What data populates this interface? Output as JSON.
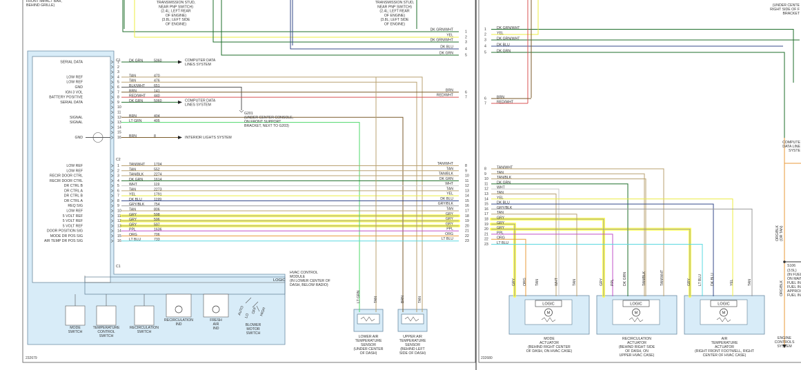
{
  "left_page": {
    "figure_number": "232679",
    "top_notes": {
      "top_left": "FRONT IMPACT BAR,\nBEHIND GRILLE)",
      "stud_1": "TRANSMISSION STUD,\nNEAR PNP SWITCH)\n(2.4L; LEFT REAR\nOF ENGINE)\n(3.8L; LEFT SIDE\nOF ENGINE)",
      "stud_2": "TRANSMISSION STUD,\nNEAR PNP SWITCH)\n(2.4L; LEFT REAR\nOF ENGINE)\n(3.8L; LEFT SIDE\nOF ENGINE)"
    },
    "top_wires": [
      {
        "num": "1",
        "label": "DK GRN/WHT"
      },
      {
        "num": "2",
        "label": "YEL"
      },
      {
        "num": "3",
        "label": "DK GRN/WHT"
      },
      {
        "num": "4",
        "label": "DK BLU"
      },
      {
        "num": "5",
        "label": "DK GRN"
      }
    ],
    "module": {
      "title": "HVAC CONTROL\nMODULE\n(IN LOWER CENTER OF\nDASH, BELOW RADIO)",
      "logic_label": "LOGIC",
      "c1_label": "C1",
      "c2_label": "C2",
      "c2_end_label": "C1"
    },
    "c1_pins": [
      {
        "pin": "1",
        "sig": "SERIAL DATA",
        "color": "DK GRN",
        "circuit": "5060",
        "dest": "COMPUTER DATA\nLINES SYSTEM",
        "right_label": "",
        "right_num": ""
      },
      {
        "pin": "2",
        "sig": "",
        "color": "",
        "circuit": "",
        "dest": "",
        "right_label": "",
        "right_num": ""
      },
      {
        "pin": "3",
        "sig": "",
        "color": "",
        "circuit": "",
        "dest": "",
        "right_label": "",
        "right_num": ""
      },
      {
        "pin": "4",
        "sig": "LOW REF",
        "color": "TAN",
        "circuit": "470",
        "dest": "",
        "right_label": "",
        "right_num": ""
      },
      {
        "pin": "5",
        "sig": "LOW REF",
        "color": "TAN",
        "circuit": "476",
        "dest": "",
        "right_label": "",
        "right_num": ""
      },
      {
        "pin": "6",
        "sig": "GND",
        "color": "BLK/WHT",
        "circuit": "651",
        "dest": "",
        "right_label": "",
        "right_num": ""
      },
      {
        "pin": "7",
        "sig": "IGN 3 VOL",
        "color": "BRN",
        "circuit": "141",
        "dest": "",
        "right_label": "BRN",
        "right_num": "6"
      },
      {
        "pin": "8",
        "sig": "BATTERY POSITIVE",
        "color": "RED/WHT",
        "circuit": "440",
        "dest": "",
        "right_label": "RED/WHT",
        "right_num": "7"
      },
      {
        "pin": "9",
        "sig": "SERIAL DATA",
        "color": "DK GRN",
        "circuit": "5060",
        "dest": "COMPUTER DATA\nLINES SYSTEM",
        "right_label": "",
        "right_num": ""
      },
      {
        "pin": "10",
        "sig": "",
        "color": "",
        "circuit": "",
        "dest": "",
        "right_label": "",
        "right_num": ""
      },
      {
        "pin": "11",
        "sig": "",
        "color": "",
        "circuit": "",
        "dest": "",
        "right_label": "",
        "right_num": ""
      },
      {
        "pin": "12",
        "sig": "SIGNAL",
        "color": "BRN",
        "circuit": "404",
        "dest": "",
        "right_label": "",
        "right_num": ""
      },
      {
        "pin": "13",
        "sig": "SIGNAL",
        "color": "LT GRN",
        "circuit": "405",
        "dest": "",
        "right_label": "",
        "right_num": ""
      },
      {
        "pin": "14",
        "sig": "",
        "color": "",
        "circuit": "",
        "dest": "",
        "right_label": "",
        "right_num": ""
      },
      {
        "pin": "15",
        "sig": "",
        "color": "",
        "circuit": "",
        "dest": "",
        "right_label": "",
        "right_num": ""
      },
      {
        "pin": "16",
        "sig": "GND",
        "color": "BRN",
        "circuit": "8",
        "dest": "INTERIOR LIGHTS SYSTEM",
        "right_label": "",
        "right_num": ""
      }
    ],
    "ground": {
      "name": "G201",
      "desc": "(UNDER CENTER CONSOLE,\nON FRONT SUPPORT\nBRACKET, NEXT TO G203)"
    },
    "c2_pins": [
      {
        "pin": "1",
        "sig": "LOW REF",
        "color": "TAN/WHT",
        "circuit": "1704",
        "right_label": "TAN/WHT",
        "right_num": "8"
      },
      {
        "pin": "2",
        "sig": "LOW REF",
        "color": "TAN",
        "circuit": "552",
        "right_label": "TAN",
        "right_num": "9"
      },
      {
        "pin": "3",
        "sig": "RECIR DOOR CTRL",
        "color": "TAN/BLK",
        "circuit": "2274",
        "right_label": "TAN/BLK",
        "right_num": "10"
      },
      {
        "pin": "4",
        "sig": "RECIR DOOR CTRL",
        "color": "DK GRN",
        "circuit": "1614",
        "right_label": "DK GRN",
        "right_num": "11"
      },
      {
        "pin": "5",
        "sig": "DR CTRL B",
        "color": "WHT",
        "circuit": "119",
        "right_label": "WHT",
        "right_num": "12"
      },
      {
        "pin": "6",
        "sig": "DR CTRL A",
        "color": "TAN",
        "circuit": "2273",
        "right_label": "TAN",
        "right_num": "13"
      },
      {
        "pin": "7",
        "sig": "DR CTRL B",
        "color": "YEL",
        "circuit": "1791",
        "right_label": "YEL",
        "right_num": "14"
      },
      {
        "pin": "8",
        "sig": "DR CTRL A",
        "color": "DK BLU",
        "circuit": "1199",
        "right_label": "DK BLU",
        "right_num": "15"
      },
      {
        "pin": "9",
        "sig": "REQ SIG",
        "color": "GRY/BLK",
        "circuit": "754",
        "right_label": "GRY/BLK",
        "right_num": "16"
      },
      {
        "pin": "10",
        "sig": "LOW REF",
        "color": "TAN",
        "circuit": "806",
        "right_label": "TAN",
        "right_num": "17"
      },
      {
        "pin": "11",
        "sig": "5 VOLT REF",
        "color": "GRY",
        "circuit": "598",
        "right_label": "GRY",
        "right_num": "18"
      },
      {
        "pin": "12",
        "sig": "5 VOLT REF",
        "color": "GRY",
        "circuit": "596",
        "right_label": "GRY",
        "right_num": "19"
      },
      {
        "pin": "13",
        "sig": "5 VOLT REF",
        "color": "GRY",
        "circuit": "597",
        "right_label": "GRY",
        "right_num": "20"
      },
      {
        "pin": "14",
        "sig": "DOOR POSITION SIG",
        "color": "PPL",
        "circuit": "1636",
        "right_label": "PPL",
        "right_num": "21"
      },
      {
        "pin": "15",
        "sig": "MODE DR POS SIG",
        "color": "ORG",
        "circuit": "706",
        "right_label": "ORG",
        "right_num": "22"
      },
      {
        "pin": "16",
        "sig": "AIR TEMP DR POS SIG",
        "color": "LT BLU",
        "circuit": "733",
        "right_label": "LT BLU",
        "right_num": "23"
      }
    ],
    "switches": [
      {
        "label": "MODE\nSWITCH"
      },
      {
        "label": "TEMPERATURE\nCONTROL\nSWITCH"
      },
      {
        "label": "RECIRCULATION\nSWITCH"
      },
      {
        "label": "RECIRCULATION\nIND"
      },
      {
        "label": "FRESH\nAIR\nIND"
      },
      {
        "label": "BLOWER\nMOTOR\nSWITCH",
        "positions": [
          "AUTO",
          "LO",
          "OFF",
          "HIGH"
        ]
      }
    ],
    "sensors": [
      {
        "label": "LOWER AIR\nTEMPERATURE\nSENSOR\n(UNDER CENTER\nOF DASH)",
        "wires": [
          "LT GRN",
          "TAN"
        ]
      },
      {
        "label": "UPPER AIR\nTEMPERATURE\nSENSOR\n(BEHIND LEFT\nSIDE OF DASH)",
        "wires": [
          "BRN",
          "TAN"
        ]
      }
    ]
  },
  "right_page": {
    "figure_number": "232680",
    "top_wires": [
      {
        "num": "1",
        "label": "DK GRN/WHT"
      },
      {
        "num": "2",
        "label": "YEL"
      },
      {
        "num": "3",
        "label": "DK GRN/WHT"
      },
      {
        "num": "4",
        "label": "DK BLU"
      },
      {
        "num": "5",
        "label": "DK GRN"
      }
    ],
    "wires_6_7": [
      {
        "num": "6",
        "label": "BRN"
      },
      {
        "num": "7",
        "label": "RED/WHT"
      }
    ],
    "wires_8_23": [
      {
        "num": "8",
        "label": "TAN/WHT"
      },
      {
        "num": "9",
        "label": "TAN"
      },
      {
        "num": "10",
        "label": "TAN/BLK"
      },
      {
        "num": "11",
        "label": "DK GRN"
      },
      {
        "num": "12",
        "label": "WHT"
      },
      {
        "num": "13",
        "label": "TAN"
      },
      {
        "num": "14",
        "label": "YEL"
      },
      {
        "num": "15",
        "label": "DK BLU"
      },
      {
        "num": "16",
        "label": "GRY/BLK"
      },
      {
        "num": "17",
        "label": "TAN"
      },
      {
        "num": "18",
        "label": "GRY"
      },
      {
        "num": "19",
        "label": "GRY"
      },
      {
        "num": "20",
        "label": "GRY"
      },
      {
        "num": "21",
        "label": "PPL"
      },
      {
        "num": "22",
        "label": "ORG"
      },
      {
        "num": "23",
        "label": "LT BLU"
      }
    ],
    "corner_note": "(UNDER CENTE\nRIGHT SIDE OF F\nBRACKET",
    "computer_note": "COMPUTE\nDATA LINE\nSYSTE",
    "splice": {
      "name": "S106",
      "desc": "(3.5L)\n(IN FUEL\nON MAIN\nFUEL IN\nFUEL IN\nAPPROX\nFUEL IN"
    },
    "side_wires": [
      "ORG/BLK",
      "(OR TAN)",
      "ORG/BLK"
    ],
    "ecs_label": "ENGINE\nCONTROLS\nSYSTEM",
    "actuators": [
      {
        "label": "MODE\nACTUATOR\n(BEHIND RIGHT CENTER\nOF DASH, ON HVAC CASE)",
        "logic": "LOGIC",
        "motor": "M",
        "wires": [
          "GRY",
          "ORG",
          "TAN",
          "WHT",
          "TAN"
        ]
      },
      {
        "label": "RECIRCULATION\nACTUATOR\n(BEHIND RIGHT SIDE\nOF DASH, ON\nUPPER HVAC CASE)",
        "logic": "LOGIC",
        "motor": "M",
        "wires": [
          "GRY",
          "PPL",
          "DK GRN",
          "TAN/BLK",
          "TAN/WHT"
        ]
      },
      {
        "label": "AIR\nTEMPERATURE\nACTUATOR\n(RIGHT FRONT FOOTWELL, RIGHT\nCENTER OF HVAC CASE)",
        "logic": "LOGIC",
        "motor": "M",
        "wires": [
          "GRY",
          "LT BLU",
          "DK BLU",
          "YEL",
          "TAN"
        ]
      }
    ]
  },
  "colors": {
    "tan": "#b8a070",
    "dk_grn": "#1e6e2a",
    "lt_grn": "#4ed86a",
    "brn": "#7a5a2a",
    "red": "#d85050",
    "yel": "#ecec40",
    "dk_blu": "#354a8a",
    "gry": "#999999",
    "ppl": "#c050c8",
    "org": "#e89a3a",
    "lt_blu": "#5ad8e0",
    "blk": "#333333",
    "wht": "#c8c8c8",
    "module_fill": "#d8ecf8",
    "highlight": "#ffff3c"
  }
}
